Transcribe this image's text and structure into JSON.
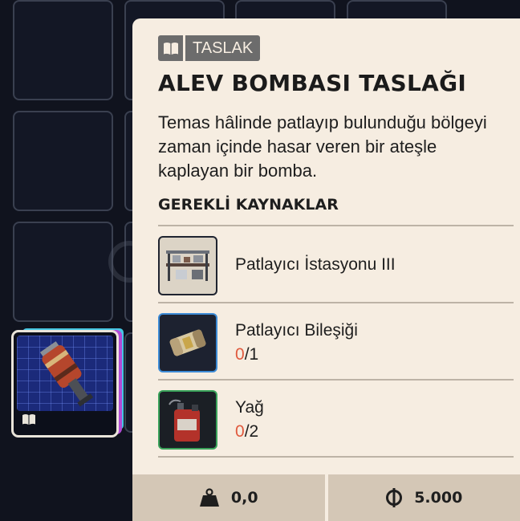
{
  "item": {
    "tag_icon": "book-icon",
    "tag_label": "TASLAK",
    "title": "ALEV BOMBASI TASLAĞI",
    "description": "Temas hâlinde patlayıp bulunduğu bölgeyi zaman içinde hasar veren bir ateşle kaplayan bir bomba."
  },
  "requirements": {
    "heading": "GEREKLİ KAYNAKLAR",
    "items": [
      {
        "name": "Patlayıcı İstasyonu III",
        "have": "",
        "sep": "",
        "need": "",
        "icon": "workbench-icon",
        "border_color": "#1f2430"
      },
      {
        "name": "Patlayıcı Bileşiği",
        "have": "0",
        "sep": "/",
        "need": "1",
        "icon": "compound-icon",
        "border_color": "#3c8bd6"
      },
      {
        "name": "Yağ",
        "have": "0",
        "sep": "/",
        "need": "2",
        "icon": "oil-can-icon",
        "border_color": "#3aa25a"
      }
    ]
  },
  "footer": {
    "weight_icon": "weight-icon",
    "weight_value": "0,0",
    "price_icon": "coin-icon",
    "price_value": "5.000"
  },
  "inventory": {
    "selected_slot_icon": "fire-grenade-icon",
    "selected_slot_badge_icon": "book-icon"
  },
  "colors": {
    "panel_bg": "#f6ede1",
    "accent_red": "#e05a3e",
    "tag_bg": "#6c6c6c"
  }
}
